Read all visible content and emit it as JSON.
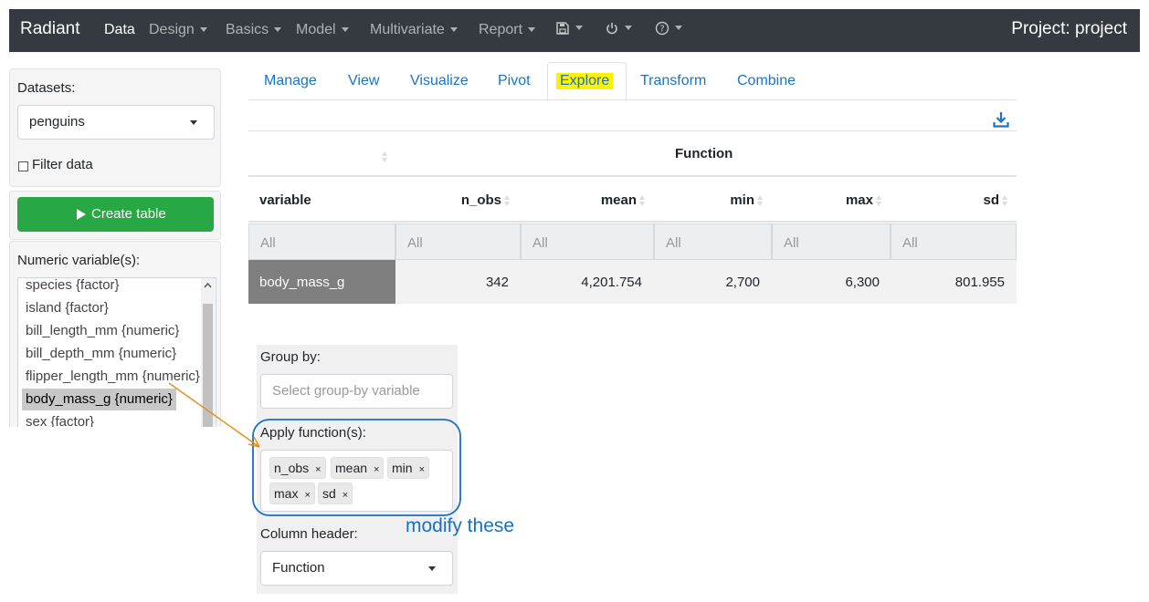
{
  "navbar": {
    "brand": "Radiant",
    "items": [
      {
        "label": "Data",
        "active": true,
        "caret": false
      },
      {
        "label": "Design",
        "caret": true
      },
      {
        "label": "Basics",
        "caret": true
      },
      {
        "label": "Model",
        "caret": true
      },
      {
        "label": "Multivariate",
        "caret": true
      },
      {
        "label": "Report",
        "caret": true
      }
    ],
    "icons": [
      "save-icon",
      "power-icon",
      "help-icon"
    ],
    "project": "Project: project"
  },
  "sidebar": {
    "datasets_label": "Datasets:",
    "dataset_value": "penguins",
    "filter_label": "Filter data",
    "create_button": "Create table",
    "numeric_label": "Numeric variable(s):",
    "variables": [
      "species {factor}",
      "island {factor}",
      "bill_length_mm {numeric}",
      "bill_depth_mm {numeric}",
      "flipper_length_mm {numeric}",
      "body_mass_g {numeric}",
      "sex {factor}"
    ],
    "selected_variable": "body_mass_g {numeric}"
  },
  "tabs": [
    "Manage",
    "View",
    "Visualize",
    "Pivot",
    "Explore",
    "Transform",
    "Combine"
  ],
  "active_tab": "Explore",
  "table": {
    "group_header": "Function",
    "columns": [
      "variable",
      "n_obs",
      "mean",
      "min",
      "max",
      "sd"
    ],
    "filters": [
      "All",
      "All",
      "All",
      "All",
      "All",
      "All"
    ],
    "row": [
      "body_mass_g",
      "342",
      "4,201.754",
      "2,700",
      "6,300",
      "801.955"
    ]
  },
  "group_panel": {
    "group_by_label": "Group by:",
    "group_by_placeholder": "Select group-by variable",
    "apply_label": "Apply function(s):",
    "functions": [
      "n_obs",
      "mean",
      "min",
      "max",
      "sd"
    ],
    "column_header_label": "Column header:",
    "column_header_value": "Function"
  },
  "annotation": {
    "text": "modify these",
    "color": "#1a6fbf",
    "arrow_color": "#e8901e"
  },
  "colors": {
    "navbar": "#343a40",
    "link": "#1a73c6",
    "create_button": "#28a745",
    "highlight": "#fff200",
    "selected_cell": "#7f7f7f"
  }
}
